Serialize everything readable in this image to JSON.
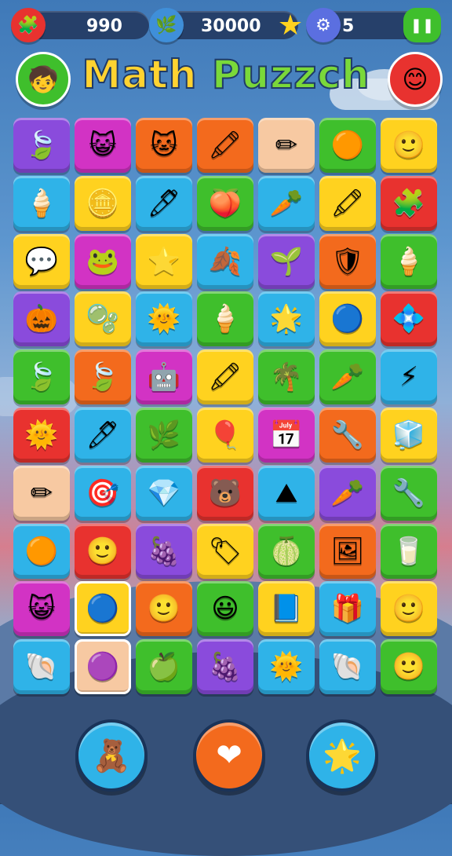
{
  "app": {
    "title_part1": "Math ",
    "title_part2": "Puzzch"
  },
  "topbar": {
    "score": "990",
    "coins": "30000",
    "moves": "5",
    "icons": [
      "puzzle-icon",
      "leaf-icon",
      "star-icon",
      "orb-icon",
      "pause-icon"
    ]
  },
  "side_buttons": {
    "left": "avatar-icon",
    "right": "face-icon"
  },
  "colors": {
    "red": "#e8322f",
    "pink": "#d233c4",
    "orange": "#f36a1d",
    "yellow": "#ffd21f",
    "green": "#3fbf2c",
    "blue": "#2fb3e8",
    "purple": "#8a4bdc",
    "cream": "#f7c9a2",
    "navy": "#26406a"
  },
  "board": {
    "rows": [
      [
        {
          "c": "purple",
          "i": "🍃"
        },
        {
          "c": "pink",
          "i": "😺"
        },
        {
          "c": "orange",
          "i": "🐱"
        },
        {
          "c": "orange",
          "i": "🖍"
        },
        {
          "c": "cream",
          "i": "✏"
        },
        {
          "c": "green",
          "i": "🟠"
        },
        {
          "c": "yellow",
          "i": "🙂"
        }
      ],
      [
        {
          "c": "blue",
          "i": "🍦"
        },
        {
          "c": "yellow",
          "i": "🪙"
        },
        {
          "c": "blue",
          "i": "🖊"
        },
        {
          "c": "green",
          "i": "🍑"
        },
        {
          "c": "blue",
          "i": "🥕"
        },
        {
          "c": "yellow",
          "i": "🖍"
        },
        {
          "c": "red",
          "i": "🧩"
        }
      ],
      [
        {
          "c": "yellow",
          "i": "💬"
        },
        {
          "c": "pink",
          "i": "🐸"
        },
        {
          "c": "yellow",
          "i": "⭐"
        },
        {
          "c": "blue",
          "i": "🍂"
        },
        {
          "c": "purple",
          "i": "🌱"
        },
        {
          "c": "orange",
          "i": "🛡"
        },
        {
          "c": "green",
          "i": "🍦"
        }
      ],
      [
        {
          "c": "purple",
          "i": "🎃"
        },
        {
          "c": "yellow",
          "i": "🫧"
        },
        {
          "c": "blue",
          "i": "🌞"
        },
        {
          "c": "green",
          "i": "🍦"
        },
        {
          "c": "blue",
          "i": "🌟"
        },
        {
          "c": "yellow",
          "i": "🔵"
        },
        {
          "c": "red",
          "i": "💠"
        }
      ],
      [
        {
          "c": "green",
          "i": "🍃"
        },
        {
          "c": "orange",
          "i": "🍃"
        },
        {
          "c": "pink",
          "i": "🤖"
        },
        {
          "c": "yellow",
          "i": "🖍"
        },
        {
          "c": "green",
          "i": "🌴"
        },
        {
          "c": "green",
          "i": "🥕"
        },
        {
          "c": "blue",
          "i": "⚡"
        }
      ],
      [
        {
          "c": "red",
          "i": "🌞"
        },
        {
          "c": "blue",
          "i": "🖊"
        },
        {
          "c": "green",
          "i": "🌿"
        },
        {
          "c": "yellow",
          "i": "🎈"
        },
        {
          "c": "pink",
          "i": "📅"
        },
        {
          "c": "orange",
          "i": "🔧"
        },
        {
          "c": "yellow",
          "i": "🧊"
        }
      ],
      [
        {
          "c": "cream",
          "i": "✏"
        },
        {
          "c": "blue",
          "i": "🎯"
        },
        {
          "c": "blue",
          "i": "💎"
        },
        {
          "c": "red",
          "i": "🐻"
        },
        {
          "c": "blue",
          "i": "⛰"
        },
        {
          "c": "purple",
          "i": "🥕"
        },
        {
          "c": "green",
          "i": "🔧"
        }
      ],
      [
        {
          "c": "blue",
          "i": "🟠"
        },
        {
          "c": "red",
          "i": "🙂"
        },
        {
          "c": "purple",
          "i": "🍇"
        },
        {
          "c": "yellow",
          "i": "🏷"
        },
        {
          "c": "green",
          "i": "🍈"
        },
        {
          "c": "orange",
          "i": "🖼"
        },
        {
          "c": "green",
          "i": "🥛"
        }
      ],
      [
        {
          "c": "pink",
          "i": "😺"
        },
        {
          "c": "yellow",
          "i": "🔵",
          "sel": true
        },
        {
          "c": "orange",
          "i": "🙂"
        },
        {
          "c": "green",
          "i": "😃"
        },
        {
          "c": "yellow",
          "i": "📘"
        },
        {
          "c": "blue",
          "i": "🎁"
        },
        {
          "c": "yellow",
          "i": "🙂"
        }
      ],
      [
        {
          "c": "blue",
          "i": "🐚"
        },
        {
          "c": "cream",
          "i": "🟣",
          "sel": true
        },
        {
          "c": "green",
          "i": "🍏"
        },
        {
          "c": "purple",
          "i": "🍇"
        },
        {
          "c": "blue",
          "i": "🌞"
        },
        {
          "c": "blue",
          "i": "🐚"
        },
        {
          "c": "green",
          "i": "🙂"
        }
      ]
    ]
  },
  "bottom_buttons": [
    {
      "name": "hint-button",
      "icon": "🧸",
      "color": "#2fb3e8"
    },
    {
      "name": "heart-button",
      "icon": "❤",
      "color": "#f36a1d"
    },
    {
      "name": "chat-button",
      "icon": "🌟",
      "color": "#2fb3e8"
    }
  ]
}
